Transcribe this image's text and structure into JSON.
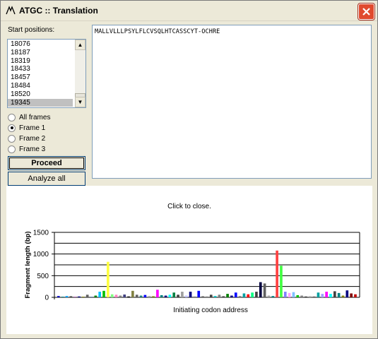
{
  "window": {
    "title": "ATGC :: Translation"
  },
  "left_panel": {
    "start_label": "Start positions:",
    "positions": [
      "18076",
      "18187",
      "18319",
      "18433",
      "18457",
      "18484",
      "18520",
      "19345"
    ],
    "selected_position": "19345",
    "frames": [
      {
        "label": "All frames",
        "checked": false
      },
      {
        "label": "Frame 1",
        "checked": true
      },
      {
        "label": "Frame 2",
        "checked": false
      },
      {
        "label": "Frame 3",
        "checked": false
      }
    ],
    "proceed_label": "Proceed",
    "analyze_label": "Analyze all"
  },
  "sequence": {
    "text": "MALLVLLLPSYLFLCVSQLHTCASSCYT-OCHRE"
  },
  "chart": {
    "close_note": "Click to close."
  },
  "chart_data": {
    "type": "bar",
    "ylabel": "Fragment length (bp)",
    "xlabel": "Initiating codon address",
    "ylim": [
      0,
      1500
    ],
    "yticks": [
      0,
      500,
      1000,
      1500
    ],
    "grid": true,
    "values": [
      {
        "v": 30,
        "c": "#0000c0"
      },
      {
        "v": 15,
        "c": "#008080"
      },
      {
        "v": 30,
        "c": "#00a0ff"
      },
      {
        "v": 25,
        "c": "#404040"
      },
      {
        "v": 10,
        "c": "#800080"
      },
      {
        "v": 20,
        "c": "#000080"
      },
      {
        "v": 15,
        "c": "#808000"
      },
      {
        "v": 60,
        "c": "#606060"
      },
      {
        "v": 10,
        "c": "#004080"
      },
      {
        "v": 40,
        "c": "#008000"
      },
      {
        "v": 130,
        "c": "#00c0ff"
      },
      {
        "v": 150,
        "c": "#00c000"
      },
      {
        "v": 820,
        "c": "#ffff40"
      },
      {
        "v": 70,
        "c": "#80ff80"
      },
      {
        "v": 60,
        "c": "#ff80c0"
      },
      {
        "v": 40,
        "c": "#808080"
      },
      {
        "v": 65,
        "c": "#404080"
      },
      {
        "v": 20,
        "c": "#000000"
      },
      {
        "v": 150,
        "c": "#808040"
      },
      {
        "v": 60,
        "c": "#606060"
      },
      {
        "v": 40,
        "c": "#208080"
      },
      {
        "v": 55,
        "c": "#0000ff"
      },
      {
        "v": 30,
        "c": "#a0a0a0"
      },
      {
        "v": 25,
        "c": "#808000"
      },
      {
        "v": 175,
        "c": "#ff00ff"
      },
      {
        "v": 50,
        "c": "#008080"
      },
      {
        "v": 40,
        "c": "#000080"
      },
      {
        "v": 60,
        "c": "#00ffff"
      },
      {
        "v": 110,
        "c": "#008040"
      },
      {
        "v": 60,
        "c": "#404040"
      },
      {
        "v": 130,
        "c": "#a0a0a0"
      },
      {
        "v": 40,
        "c": "#c0c0ff"
      },
      {
        "v": 130,
        "c": "#000080"
      },
      {
        "v": 20,
        "c": "#808080"
      },
      {
        "v": 150,
        "c": "#0000ff"
      },
      {
        "v": 25,
        "c": "#606060"
      },
      {
        "v": 20,
        "c": "#808080"
      },
      {
        "v": 60,
        "c": "#404040"
      },
      {
        "v": 30,
        "c": "#00c0c0"
      },
      {
        "v": 60,
        "c": "#808080"
      },
      {
        "v": 25,
        "c": "#404040"
      },
      {
        "v": 80,
        "c": "#008000"
      },
      {
        "v": 40,
        "c": "#000080"
      },
      {
        "v": 110,
        "c": "#0000ff"
      },
      {
        "v": 30,
        "c": "#808080"
      },
      {
        "v": 90,
        "c": "#00a0a0"
      },
      {
        "v": 70,
        "c": "#ff0000"
      },
      {
        "v": 110,
        "c": "#00ff80"
      },
      {
        "v": 130,
        "c": "#404040"
      },
      {
        "v": 350,
        "c": "#000040"
      },
      {
        "v": 320,
        "c": "#606060"
      },
      {
        "v": 40,
        "c": "#a0a0a0"
      },
      {
        "v": 30,
        "c": "#008080"
      },
      {
        "v": 1080,
        "c": "#ff4040"
      },
      {
        "v": 730,
        "c": "#40ff40"
      },
      {
        "v": 130,
        "c": "#8080ff"
      },
      {
        "v": 100,
        "c": "#ffa0ff"
      },
      {
        "v": 120,
        "c": "#80c0ff"
      },
      {
        "v": 50,
        "c": "#00c000"
      },
      {
        "v": 40,
        "c": "#808080"
      },
      {
        "v": 20,
        "c": "#404040"
      },
      {
        "v": 25,
        "c": "#a0a0a0"
      },
      {
        "v": 20,
        "c": "#606060"
      },
      {
        "v": 110,
        "c": "#00a0a0"
      },
      {
        "v": 80,
        "c": "#a0a0ff"
      },
      {
        "v": 130,
        "c": "#ff00ff"
      },
      {
        "v": 80,
        "c": "#00ffff"
      },
      {
        "v": 140,
        "c": "#404040"
      },
      {
        "v": 100,
        "c": "#008080"
      },
      {
        "v": 40,
        "c": "#808000"
      },
      {
        "v": 160,
        "c": "#000080"
      },
      {
        "v": 90,
        "c": "#800000"
      },
      {
        "v": 70,
        "c": "#c00000"
      }
    ]
  }
}
